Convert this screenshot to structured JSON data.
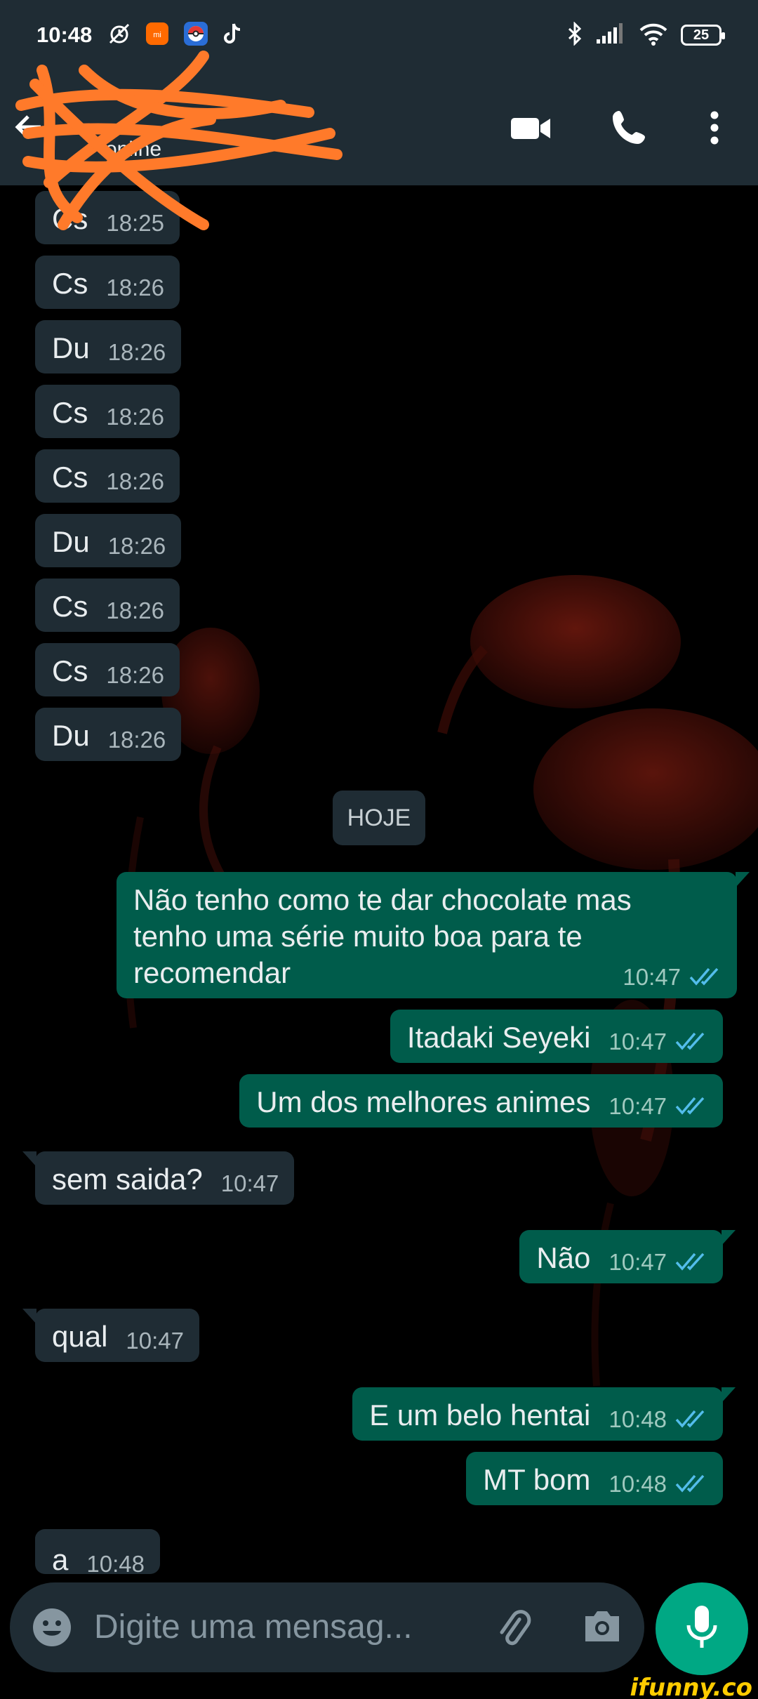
{
  "status_bar": {
    "time": "10:48",
    "battery": "25",
    "icons": [
      "muted-alarm-icon",
      "mi-app-icon",
      "pokeball-icon",
      "tiktok-icon",
      "bluetooth-icon",
      "signal-icon",
      "wifi-icon"
    ]
  },
  "header": {
    "contact_status": "online",
    "icons": [
      "back-arrow-icon",
      "video-call-icon",
      "phone-icon",
      "more-vert-icon"
    ]
  },
  "date_chip": "HOJE",
  "messages": [
    {
      "dir": "in",
      "text": "Cs",
      "time": "18:25"
    },
    {
      "dir": "in",
      "text": "Cs",
      "time": "18:26"
    },
    {
      "dir": "in",
      "text": "Du",
      "time": "18:26"
    },
    {
      "dir": "in",
      "text": "Cs",
      "time": "18:26"
    },
    {
      "dir": "in",
      "text": "Cs",
      "time": "18:26"
    },
    {
      "dir": "in",
      "text": "Du",
      "time": "18:26"
    },
    {
      "dir": "in",
      "text": "Cs",
      "time": "18:26"
    },
    {
      "dir": "in",
      "text": "Cs",
      "time": "18:26"
    },
    {
      "dir": "in",
      "text": "Du",
      "time": "18:26"
    },
    {
      "dir": "out",
      "lines": [
        "Não tenho como te dar chocolate mas",
        "tenho uma série muito boa para te",
        "recomendar"
      ],
      "time": "10:47"
    },
    {
      "dir": "out",
      "text": "Itadaki Seyeki",
      "time": "10:47"
    },
    {
      "dir": "out",
      "text": "Um dos melhores animes",
      "time": "10:47"
    },
    {
      "dir": "in",
      "text": "sem saida?",
      "time": "10:47"
    },
    {
      "dir": "out",
      "text": "Não",
      "time": "10:47"
    },
    {
      "dir": "in",
      "text": "qual",
      "time": "10:47"
    },
    {
      "dir": "out",
      "text": "E um belo hentai",
      "time": "10:48"
    },
    {
      "dir": "out",
      "text": "MT bom",
      "time": "10:48"
    },
    {
      "dir": "in",
      "text": "a",
      "time": "10:48"
    }
  ],
  "composer": {
    "placeholder": "Digite uma mensag...",
    "icons": [
      "emoji-icon",
      "attach-icon",
      "camera-icon",
      "mic-icon"
    ]
  },
  "watermark": "ifunny.co",
  "colors": {
    "incoming_bubble": "#1f2c34",
    "outgoing_bubble": "#005c4b",
    "header": "#1f2c34",
    "read_ticks": "#53bdeb",
    "mic_button": "#00a884",
    "scribble": "#ff7a2a"
  }
}
